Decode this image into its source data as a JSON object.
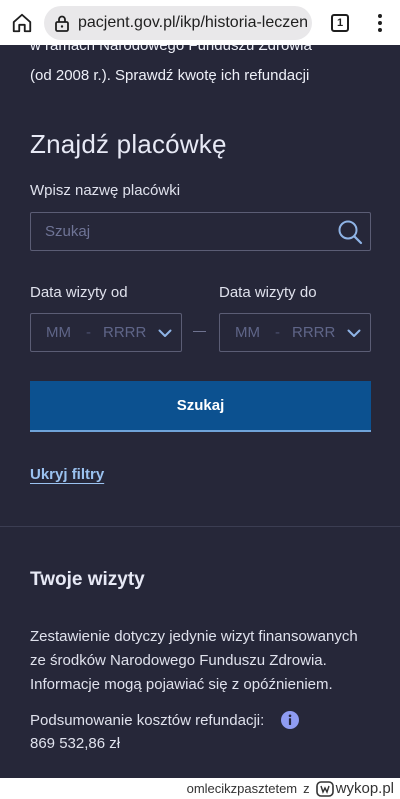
{
  "browser": {
    "url": "pacjent.gov.pl/ikp/historia-leczen",
    "tab_count": "1"
  },
  "intro": {
    "line1": "w ramach Narodowego Funduszu Zdrowia",
    "line2": "(od 2008 r.). Sprawdź kwotę ich refundacji"
  },
  "filters": {
    "title": "Znajdź placówkę",
    "name_label": "Wpisz nazwę placówki",
    "search_placeholder": "Szukaj",
    "date_from_label": "Data wizyty od",
    "date_to_label": "Data wizyty do",
    "month_placeholder": "MM",
    "year_placeholder": "RRRR",
    "search_button": "Szukaj",
    "hide_filters_link": "Ukryj filtry"
  },
  "visits": {
    "title": "Twoje wizyty",
    "description": [
      "Zestawienie dotyczy jedynie wizyt finansowanych",
      "ze środków Narodowego Funduszu Zdrowia.",
      "Informacje mogą pojawiać się z opóźnieniem."
    ],
    "refund_summary_label": "Podsumowanie kosztów refundacji:",
    "refund_summary_value": "869 532,86 zł"
  },
  "watermark": {
    "user": "omlecikzpasztetem",
    "connector": "z",
    "site": "wykop.pl"
  },
  "colors": {
    "page_bg": "#262739",
    "button_bg": "#0c5190",
    "link": "#9bc2f0",
    "info_icon": "#8f9cf2"
  }
}
